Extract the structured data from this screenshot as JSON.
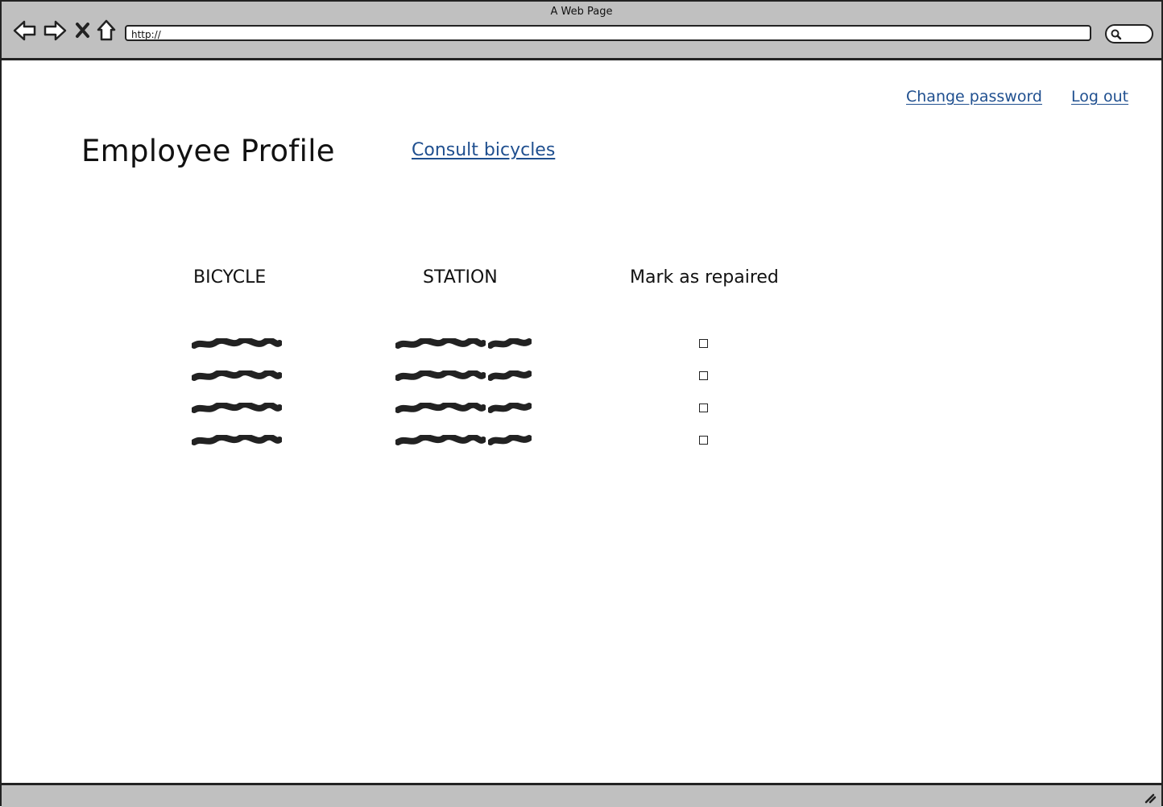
{
  "window": {
    "title": "A Web Page"
  },
  "browser": {
    "url": "http://"
  },
  "header": {
    "change_password": "Change password",
    "log_out": "Log out"
  },
  "page": {
    "title": "Employee Profile",
    "consult_link": "Consult bicycles"
  },
  "table": {
    "columns": [
      "BICYCLE",
      "STATION",
      "Mark as repaired"
    ],
    "rows": [
      {
        "bicycle": "",
        "station": "",
        "repaired": false
      },
      {
        "bicycle": "",
        "station": "",
        "repaired": false
      },
      {
        "bicycle": "",
        "station": "",
        "repaired": false
      },
      {
        "bicycle": "",
        "station": "",
        "repaired": false
      }
    ]
  },
  "icons": [
    "back-icon",
    "forward-icon",
    "stop-icon",
    "home-icon",
    "search-icon",
    "resize-grip-icon"
  ]
}
